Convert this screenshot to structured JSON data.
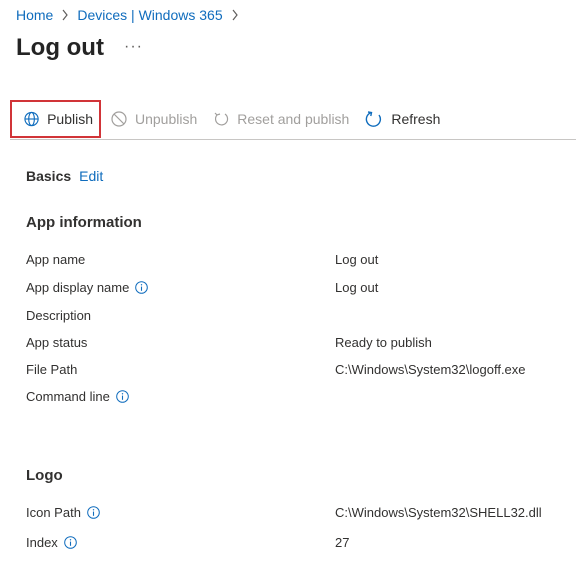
{
  "breadcrumb": {
    "home": "Home",
    "devices": "Devices | Windows 365"
  },
  "page": {
    "title": "Log out",
    "more": "···"
  },
  "toolbar": {
    "publish": "Publish",
    "unpublish": "Unpublish",
    "reset_publish": "Reset and publish",
    "refresh": "Refresh"
  },
  "basics": {
    "label": "Basics",
    "edit": "Edit"
  },
  "app_info": {
    "heading": "App information",
    "rows": [
      {
        "label": "App name",
        "value": "Log out"
      },
      {
        "label": "App display name",
        "value": "Log out"
      },
      {
        "label": "Description",
        "value": ""
      },
      {
        "label": "App status",
        "value": "Ready to publish"
      },
      {
        "label": "File Path",
        "value": "C:\\Windows\\System32\\logoff.exe"
      },
      {
        "label": "Command line",
        "value": ""
      }
    ]
  },
  "logo": {
    "heading": "Logo",
    "rows": [
      {
        "label": "Icon Path",
        "value": "C:\\Windows\\System32\\SHELL32.dll"
      },
      {
        "label": "Index",
        "value": "27"
      }
    ]
  },
  "colors": {
    "accent": "#0f6cbd",
    "highlight": "#d13438",
    "disabled": "#a19f9d"
  }
}
